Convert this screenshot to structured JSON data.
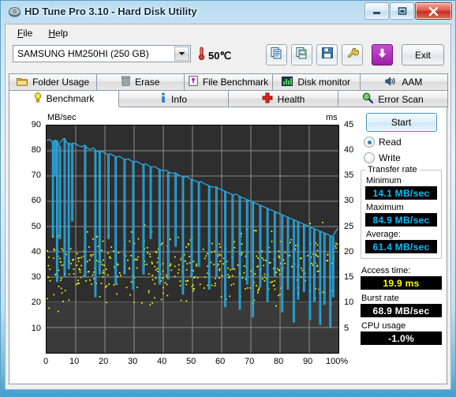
{
  "window": {
    "title": "HD Tune Pro 3.10 - Hard Disk Utility",
    "app_icon": "hdd-icon",
    "minimize_icon": "minimize-icon",
    "maximize_icon": "maximize-icon",
    "close_icon": "close-icon"
  },
  "menu": {
    "items": [
      {
        "label": "File",
        "accel": "F"
      },
      {
        "label": "Help",
        "accel": "H"
      }
    ]
  },
  "toolbar": {
    "drive": "SAMSUNG HM250HI (250 GB)",
    "drive_dropdown_icon": "chevron-down-icon",
    "temperature": "50℃",
    "thermometer_icon": "thermometer-icon",
    "buttons": [
      {
        "name": "copy-text-button",
        "icon": "copy-text-icon"
      },
      {
        "name": "copy-image-button",
        "icon": "copy-image-icon"
      },
      {
        "name": "save-button",
        "icon": "floppy-disk-icon"
      },
      {
        "name": "options-button",
        "icon": "wrench-icon"
      },
      {
        "name": "download-button",
        "icon": "download-arrow-icon"
      }
    ],
    "exit_label": "Exit"
  },
  "tabs_top": [
    {
      "label": "Folder Usage",
      "icon": "folder-icon",
      "active": false
    },
    {
      "label": "Erase",
      "icon": "trash-icon",
      "active": false
    },
    {
      "label": "File Benchmark",
      "icon": "file-benchmark-icon",
      "active": false
    },
    {
      "label": "Disk monitor",
      "icon": "bar-chart-icon",
      "active": false
    },
    {
      "label": "AAM",
      "icon": "speaker-icon",
      "active": false
    }
  ],
  "tabs_main": [
    {
      "label": "Benchmark",
      "icon": "lightbulb-icon",
      "active": true
    },
    {
      "label": "Info",
      "icon": "info-icon",
      "active": false
    },
    {
      "label": "Health",
      "icon": "red-cross-icon",
      "active": false
    },
    {
      "label": "Error Scan",
      "icon": "magnifier-icon",
      "active": false
    }
  ],
  "controls": {
    "start_label": "Start",
    "mode_read": "Read",
    "mode_write": "Write",
    "mode_selected": "Read"
  },
  "results": {
    "transfer_rate_group": "Transfer rate",
    "minimum_label": "Minimum",
    "minimum_value": "14.1 MB/sec",
    "maximum_label": "Maximum",
    "maximum_value": "84.9 MB/sec",
    "average_label": "Average:",
    "average_value": "61.4 MB/sec",
    "access_time_label": "Access time:",
    "access_time_value": "19.9 ms",
    "burst_rate_label": "Burst rate",
    "burst_rate_value": "68.9 MB/sec",
    "cpu_usage_label": "CPU usage",
    "cpu_usage_value": "-1.0%"
  },
  "colors": {
    "transfer_curve": "#29ABE2",
    "access_points": "#FFFF00",
    "plot_background": "#2e2e2e",
    "value_cyan": "#00BFFF",
    "value_yellow": "#FFFF00",
    "value_white": "#FFFFFF",
    "accent_blue": "#3f8ebc"
  },
  "chart_data": {
    "type": "line",
    "title": "",
    "ylabel": "MB/sec",
    "y2label": "ms",
    "xlabel": "",
    "xlim": [
      0,
      100
    ],
    "ylim": [
      0,
      90
    ],
    "y2lim": [
      0,
      45
    ],
    "grid": true,
    "xticks": [
      "0",
      "10",
      "20",
      "30",
      "40",
      "50",
      "60",
      "70",
      "80",
      "90",
      "100%"
    ],
    "yticks": [
      "10",
      "20",
      "30",
      "40",
      "50",
      "60",
      "70",
      "80",
      "90"
    ],
    "y2ticks": [
      "5",
      "10",
      "15",
      "20",
      "25",
      "30",
      "35",
      "40",
      "45"
    ],
    "series": [
      {
        "name": "Transfer rate",
        "axis": "left",
        "color": "#29ABE2",
        "units": "MB/sec",
        "x": [
          0,
          1,
          2,
          3,
          4,
          5,
          6,
          7,
          8,
          9,
          10,
          11,
          12,
          13,
          14,
          15,
          16,
          17,
          18,
          19,
          20,
          21,
          22,
          23,
          24,
          25,
          26,
          27,
          28,
          29,
          30,
          31,
          32,
          33,
          34,
          35,
          36,
          37,
          38,
          39,
          40,
          41,
          42,
          43,
          44,
          45,
          46,
          47,
          48,
          49,
          50,
          51,
          52,
          53,
          54,
          55,
          56,
          57,
          58,
          59,
          60,
          61,
          62,
          63,
          64,
          65,
          66,
          67,
          68,
          69,
          70,
          71,
          72,
          73,
          74,
          75,
          76,
          77,
          78,
          79,
          80,
          81,
          82,
          83,
          84,
          85,
          86,
          87,
          88,
          89,
          90,
          91,
          92,
          93,
          94,
          95,
          96,
          97,
          98,
          99,
          100
        ],
        "values": [
          84.0,
          84.5,
          83.5,
          84.2,
          82.0,
          83.8,
          84.9,
          83.2,
          82.5,
          83.0,
          82.8,
          82.0,
          81.5,
          82.2,
          81.0,
          80.5,
          81.2,
          80.0,
          79.5,
          79.8,
          79.0,
          78.5,
          78.8,
          78.0,
          77.5,
          77.8,
          77.0,
          76.5,
          76.8,
          76.0,
          75.5,
          75.8,
          75.0,
          74.5,
          74.8,
          74.0,
          73.5,
          73.8,
          73.0,
          72.5,
          72.0,
          72.3,
          71.5,
          71.0,
          71.3,
          70.5,
          70.0,
          69.5,
          69.8,
          69.0,
          68.5,
          68.0,
          67.5,
          67.8,
          67.0,
          66.5,
          66.0,
          65.5,
          65.8,
          65.0,
          64.5,
          64.0,
          63.5,
          63.0,
          62.5,
          62.8,
          62.0,
          61.5,
          61.0,
          60.5,
          60.0,
          59.5,
          59.0,
          58.5,
          58.0,
          57.5,
          57.0,
          56.5,
          56.0,
          55.5,
          55.0,
          54.5,
          54.0,
          53.5,
          53.0,
          52.5,
          52.0,
          51.5,
          51.0,
          50.5,
          50.0,
          49.5,
          49.0,
          48.5,
          48.0,
          47.5,
          47.0,
          46.5,
          46.0,
          48.0,
          49.5
        ]
      },
      {
        "name": "Access time",
        "axis": "right",
        "color": "#FFFF00",
        "units": "ms",
        "marker": "dot",
        "note": "Scatter of random access seek samples, clustered between roughly 13 and 28 ms across the full 0-100% span, with a dense band near 17-24 ms."
      }
    ]
  }
}
